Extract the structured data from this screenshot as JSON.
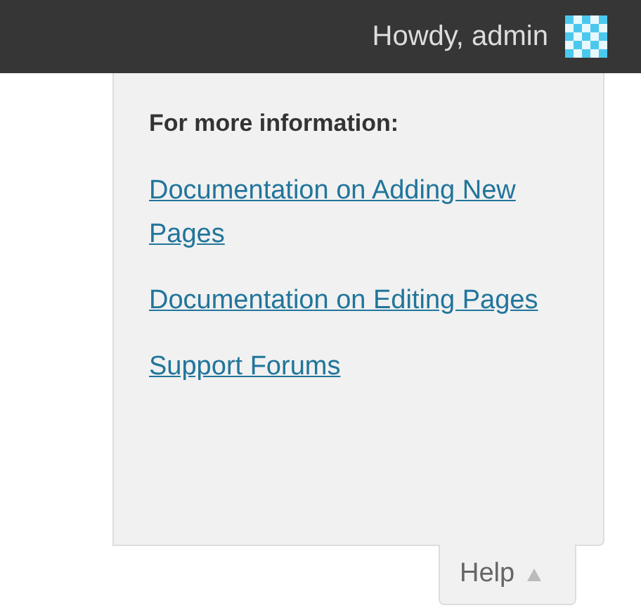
{
  "admin_bar": {
    "greeting": "Howdy, admin"
  },
  "help_panel": {
    "heading": "For more information:",
    "links": [
      "Documentation on Adding New Pages",
      "Documentation on Editing Pages",
      "Support Forums"
    ]
  },
  "help_tab": {
    "label": "Help",
    "expanded": true
  }
}
